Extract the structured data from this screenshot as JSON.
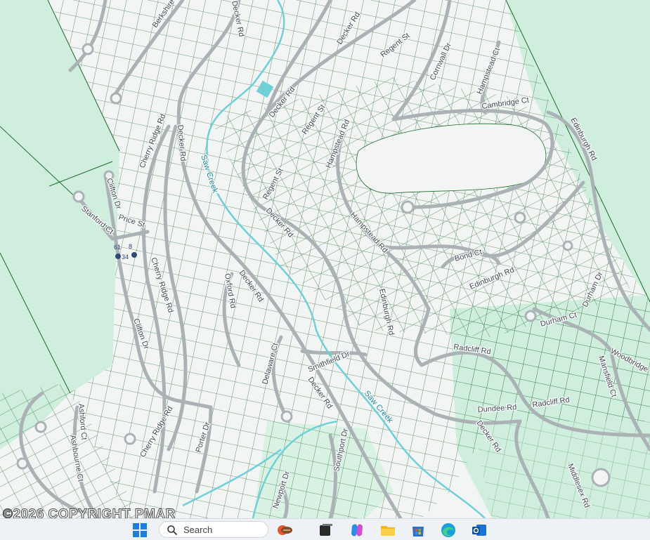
{
  "map": {
    "roads": [
      "Berkshire",
      "Decker Rd",
      "Decker Rd",
      "Decker Rd",
      "Decker Rd",
      "Decker Rd",
      "Decker Rd",
      "Regent St",
      "Regent St",
      "Regent St",
      "Cornwall Dr",
      "Hampstead Ct",
      "Cambridge Ct",
      "Edinburgh Rd",
      "Hampstead Rd",
      "Hampstead Rd",
      "Cherry Ridge Rd",
      "Cherry Ridge Rd",
      "Cherry Ridge Rd",
      "Clifton Dr",
      "Clifton Dr",
      "Price St",
      "Stanford Ct",
      "Bond Ct",
      "Edinburgh Rd",
      "Edinburgh Rd",
      "Durham Ct",
      "Durham Dr",
      "Woodbridge",
      "Radcliff Rd",
      "Radcliff Rd",
      "Dundee Rd",
      "Mansfield Ct",
      "Smithfield Dr",
      "Delaware Ct",
      "Oxford Rd",
      "Porter Dr",
      "Southport Dr",
      "Newport Dr",
      "Middlesex Rd",
      "Ashford Ct",
      "Ashbourne Ct"
    ],
    "waterways": [
      "Saw Creek",
      "Saw Creek"
    ],
    "markers": [
      "61",
      "8",
      "34"
    ],
    "colors": {
      "land": "#f3f4f4",
      "woodland": "#cfeedd",
      "parcel_line": "#1f6b2c",
      "road": "#aab2b6",
      "creek": "#6fd0d8"
    }
  },
  "copyright": "©2026 COPYRIGHT PMAR",
  "taskbar": {
    "search_label": "Search",
    "icons": [
      "windows-start-icon",
      "search-icon",
      "widgets-icon",
      "task-view-icon",
      "copilot-icon",
      "file-explorer-icon",
      "microsoft-store-icon",
      "edge-icon",
      "outlook-icon"
    ]
  }
}
